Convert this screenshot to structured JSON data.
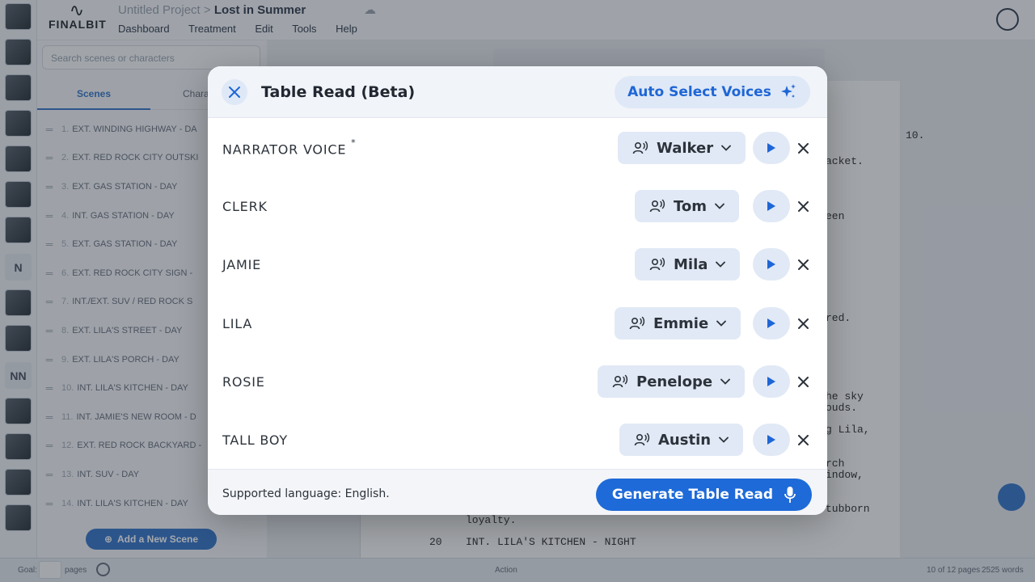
{
  "app": {
    "logo_text": "FINALBIT",
    "project_name": "Untitled Project",
    "breadcrumb_sep": ">",
    "script_title": "Lost in Summer",
    "menu": [
      "Dashboard",
      "Treatment",
      "Edit",
      "Tools",
      "Help"
    ]
  },
  "thumbstrip": {
    "letters": [
      "N",
      "NN"
    ]
  },
  "sidebar": {
    "search_placeholder": "Search scenes or characters",
    "tab_scenes": "Scenes",
    "tab_characters": "Chara",
    "scenes": [
      {
        "num": "1.",
        "title": "EXT. WINDING HIGHWAY - DA"
      },
      {
        "num": "2.",
        "title": "EXT. RED ROCK CITY OUTSKI"
      },
      {
        "num": "3.",
        "title": "EXT. GAS STATION - DAY"
      },
      {
        "num": "4.",
        "title": "INT. GAS STATION - DAY"
      },
      {
        "num": "5.",
        "title": "EXT. GAS STATION - DAY"
      },
      {
        "num": "6.",
        "title": "EXT. RED ROCK CITY SIGN -"
      },
      {
        "num": "7.",
        "title": "INT./EXT. SUV / RED ROCK S"
      },
      {
        "num": "8.",
        "title": "EXT. LILA'S STREET - DAY"
      },
      {
        "num": "9.",
        "title": "EXT. LILA'S PORCH - DAY"
      },
      {
        "num": "10.",
        "title": "INT. LILA'S KITCHEN - DAY"
      },
      {
        "num": "11.",
        "title": "INT. JAMIE'S NEW ROOM - D"
      },
      {
        "num": "12.",
        "title": "EXT. RED ROCK BACKYARD -"
      },
      {
        "num": "13.",
        "title": "INT. SUV - DAY"
      },
      {
        "num": "14.",
        "title": "INT. LILA'S KITCHEN - DAY"
      }
    ],
    "add_scene_label": "Add a New Scene"
  },
  "page": {
    "page_number": "10.",
    "fragments": [
      "acket.",
      "een",
      "red.",
      "he sky",
      "ouds.",
      "g Lila,",
      "rch",
      "indow,",
      "tubborn",
      "loyalty."
    ],
    "scene_line_num": "20",
    "scene_line_text": "INT. LILA'S KITCHEN - NIGHT"
  },
  "statusbar": {
    "goal_label": "Goal:",
    "pages_label": "pages",
    "action_label": "Action",
    "page_count": "10 of 12 pages",
    "word_count": "2525 words"
  },
  "modal": {
    "title": "Table Read (Beta)",
    "auto_select_label": "Auto Select Voices",
    "rows": [
      {
        "character": "NARRATOR VOICE",
        "marker": "*",
        "voice": "Walker"
      },
      {
        "character": "CLERK",
        "marker": "",
        "voice": "Tom"
      },
      {
        "character": "JAMIE",
        "marker": "",
        "voice": "Mila"
      },
      {
        "character": "LILA",
        "marker": "",
        "voice": "Emmie"
      },
      {
        "character": "ROSIE",
        "marker": "",
        "voice": "Penelope"
      },
      {
        "character": "TALL BOY",
        "marker": "",
        "voice": "Austin"
      }
    ],
    "language_note": "Supported language: English.",
    "generate_label": "Generate Table Read"
  },
  "colors": {
    "accent": "#1e6ad8",
    "chip_bg": "#e1e9f6",
    "header_bg": "#f1f4f9"
  }
}
